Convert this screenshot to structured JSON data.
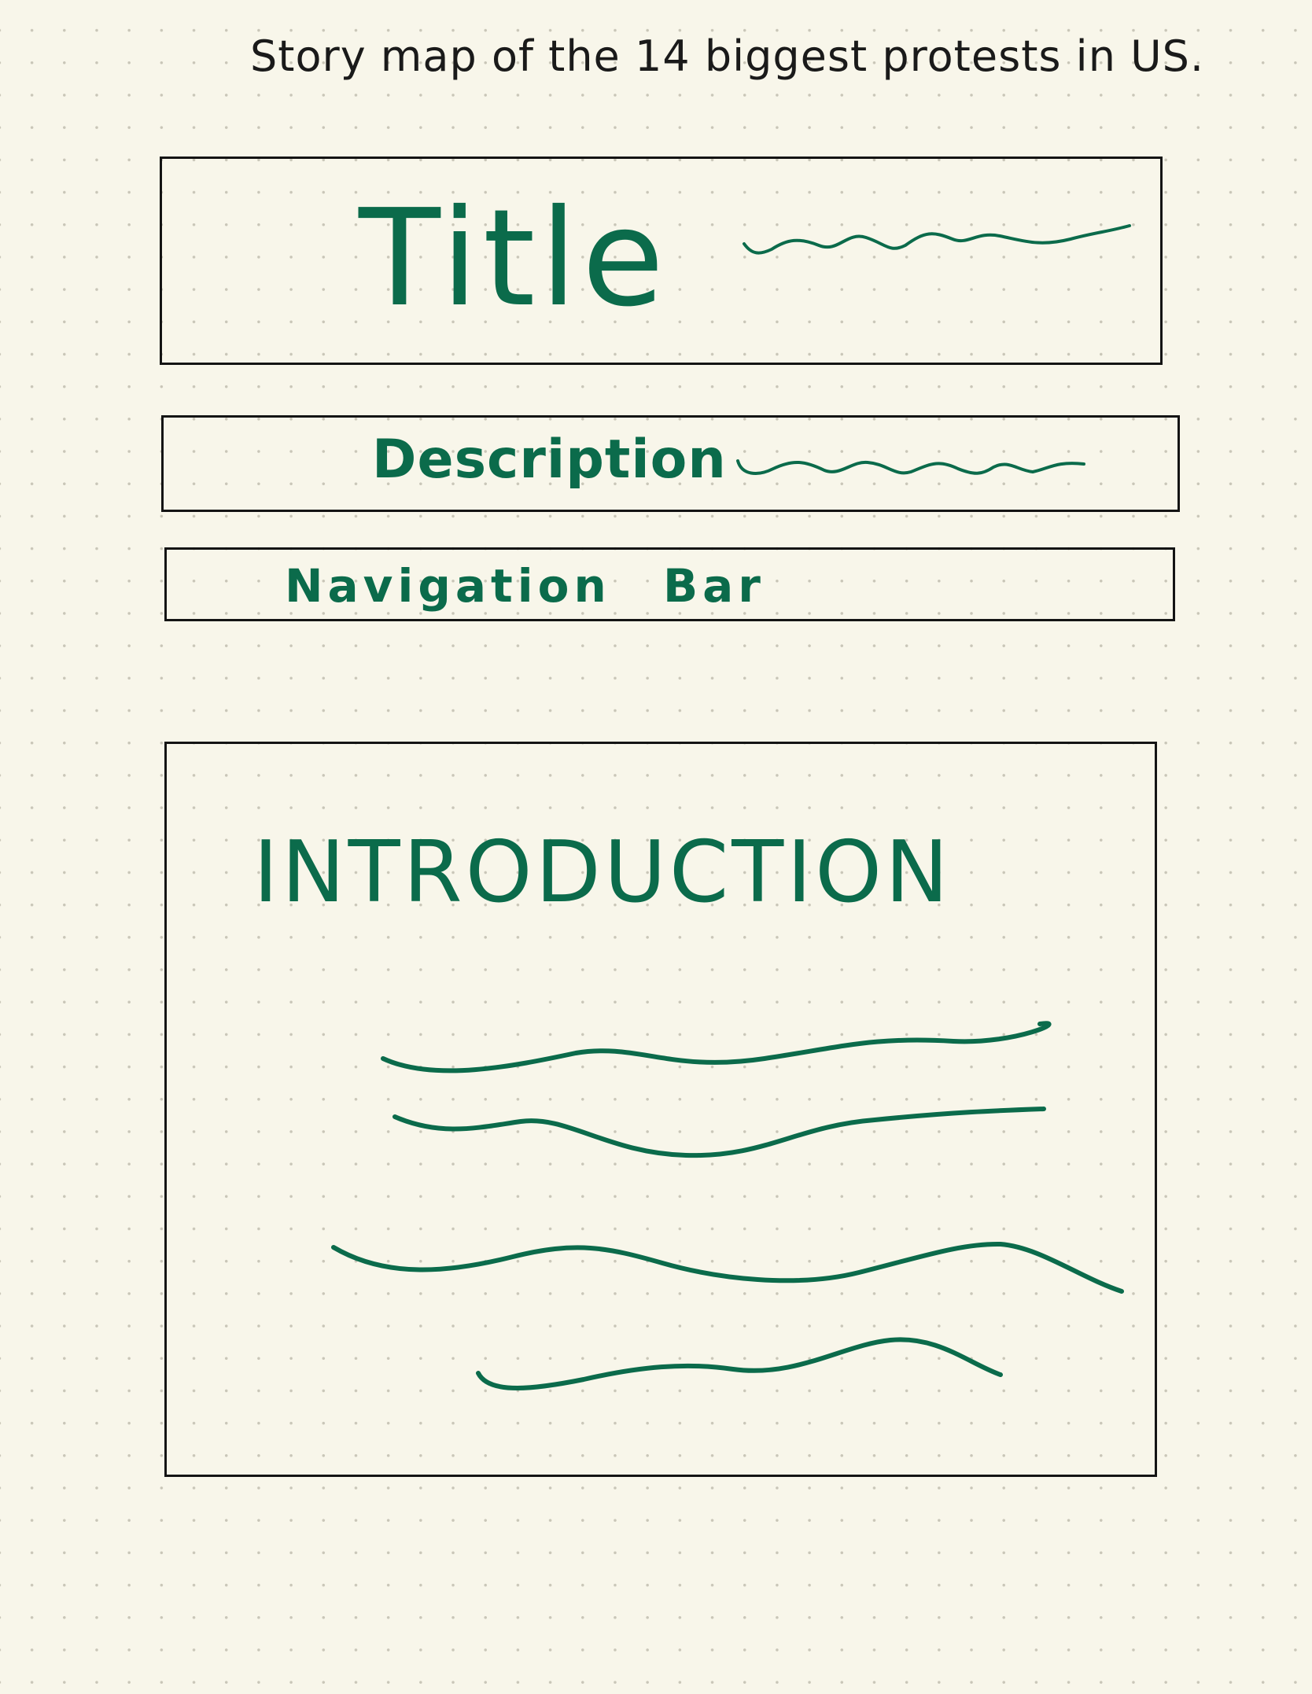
{
  "header": {
    "caption": "Story map of the 14 biggest protests in US."
  },
  "sections": {
    "title_label": "Title",
    "description_label": "Description",
    "navigation_label": "Navigation Bar",
    "introduction_label": "INTRODUCTION"
  },
  "colors": {
    "ink": "#141414",
    "marker_green": "#0b6b4b",
    "paper": "#f8f6ea",
    "grid_dot": "#c9c6b8"
  }
}
